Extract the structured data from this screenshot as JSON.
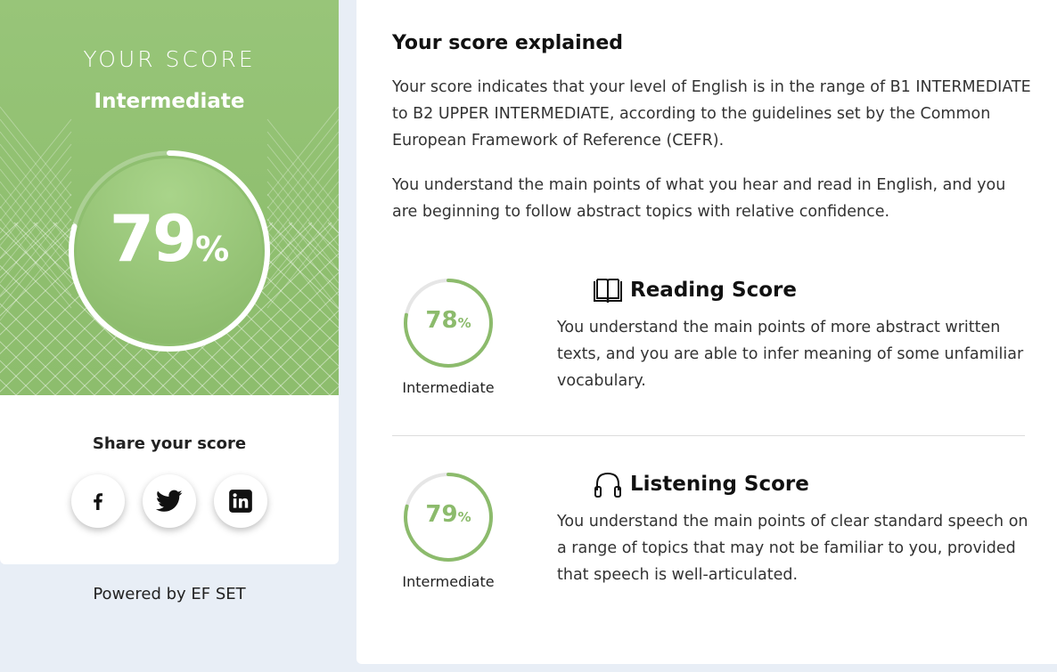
{
  "score_card": {
    "heading": "YOUR SCORE",
    "level": "Intermediate",
    "value": "79",
    "unit": "%",
    "progress": 0.79,
    "share_title": "Share your score",
    "social": [
      {
        "name": "facebook-icon",
        "glyph": "f"
      },
      {
        "name": "twitter-icon",
        "glyph": "twitter"
      },
      {
        "name": "linkedin-icon",
        "glyph": "in"
      }
    ],
    "powered_by": "Powered by EF SET"
  },
  "explanation": {
    "title": "Your score explained",
    "paragraph1": "Your score indicates that your level of English is in the range of B1 INTERMEDIATE to B2 UPPER INTERMEDIATE, according to the guidelines set by the Common European Framework of Reference (CEFR).",
    "paragraph2": "You understand the main points of what you hear and read in English, and you are beginning to follow abstract topics with relative confidence."
  },
  "sections": [
    {
      "icon": "book-icon",
      "title": "Reading Score",
      "value": "78",
      "unit": "%",
      "progress": 0.78,
      "level": "Intermediate",
      "description": "You understand the main points of more abstract written texts, and you are able to infer meaning of some unfamiliar vocabulary."
    },
    {
      "icon": "headphones-icon",
      "title": "Listening Score",
      "value": "79",
      "unit": "%",
      "progress": 0.79,
      "level": "Intermediate",
      "description": "You understand the main points of clear standard speech on a range of topics that may not be familiar to you, provided that speech is well-articulated."
    }
  ],
  "colors": {
    "accent": "#8cbb6c",
    "hero_green": "#93c273",
    "background": "#e8eef6"
  }
}
